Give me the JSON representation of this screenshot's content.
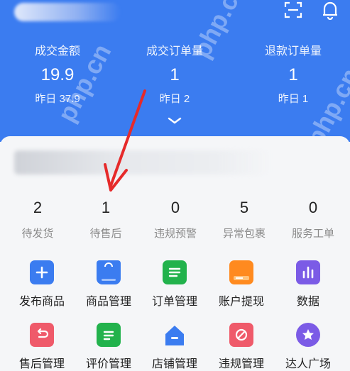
{
  "stats": [
    {
      "label": "成交金额",
      "value": "19.9",
      "yesterday": "昨日 37.9"
    },
    {
      "label": "成交订单量",
      "value": "1",
      "yesterday": "昨日 2"
    },
    {
      "label": "退款订单量",
      "value": "1",
      "yesterday": "昨日 1"
    }
  ],
  "counts": [
    {
      "num": "2",
      "label": "待发货"
    },
    {
      "num": "1",
      "label": "待售后"
    },
    {
      "num": "0",
      "label": "违规预警"
    },
    {
      "num": "5",
      "label": "异常包裹"
    },
    {
      "num": "0",
      "label": "服务工单"
    }
  ],
  "tools_row1": [
    {
      "label": "发布商品",
      "icon": "plus-icon",
      "color": "#3b7cf0"
    },
    {
      "label": "商品管理",
      "icon": "bag-icon",
      "color": "#3b7cf0"
    },
    {
      "label": "订单管理",
      "icon": "orders-icon",
      "color": "#22b24c"
    },
    {
      "label": "账户提现",
      "icon": "wallet-icon",
      "color": "#ff8a1f"
    },
    {
      "label": "数据",
      "icon": "chart-icon",
      "color": "#7b5be6"
    }
  ],
  "tools_row2": [
    {
      "label": "售后管理",
      "icon": "return-icon",
      "color": "#ef5a6a"
    },
    {
      "label": "评价管理",
      "icon": "review-icon",
      "color": "#22b24c"
    },
    {
      "label": "店铺管理",
      "icon": "store-icon",
      "color": "#3b7cf0"
    },
    {
      "label": "违规管理",
      "icon": "violation-icon",
      "color": "#ef5a6a"
    },
    {
      "label": "达人广场",
      "icon": "star-badge-icon",
      "color": "#7b5be6"
    }
  ],
  "watermark": "php.cn"
}
